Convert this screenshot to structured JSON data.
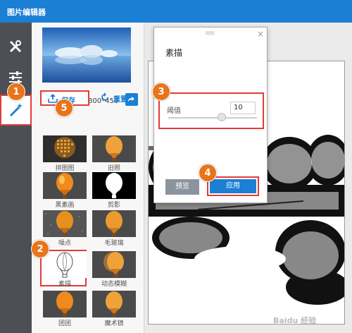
{
  "app": {
    "title": "图片编辑器"
  },
  "toolbar": {
    "tools": [
      {
        "icon": "tools-icon"
      },
      {
        "icon": "sliders-icon"
      },
      {
        "icon": "magic-wand-icon",
        "active": true
      }
    ]
  },
  "image_panel": {
    "size_label": "大小：800*450",
    "save_label": "保存",
    "reset_label": "重置",
    "effects": [
      {
        "label": "拼图图"
      },
      {
        "label": "旧照"
      },
      {
        "label": "黑素画"
      },
      {
        "label": "剪影"
      },
      {
        "label": "噪点"
      },
      {
        "label": "毛玻璃"
      },
      {
        "label": "素描",
        "selected": true
      },
      {
        "label": "动态模糊"
      },
      {
        "label": "团团"
      },
      {
        "label": "魔术镜"
      }
    ]
  },
  "dialog": {
    "title": "素描",
    "param_label": "阈值",
    "param_value": "10",
    "slider_fraction": 0.6,
    "preview_label": "预览",
    "apply_label": "应用"
  },
  "badges": [
    "1",
    "2",
    "3",
    "4",
    "5"
  ],
  "watermark": "Baidu 经验",
  "colors": {
    "accent": "#1b7fd4",
    "highlight": "#e23b3b",
    "badge": "#e8751a"
  }
}
